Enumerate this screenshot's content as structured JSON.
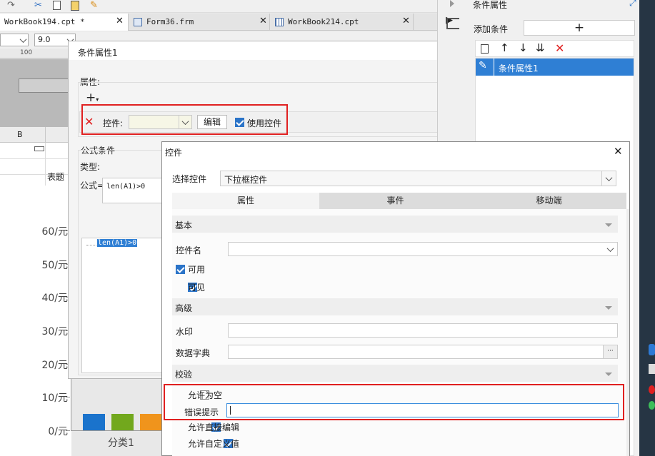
{
  "tabs": [
    {
      "label": "WorkBook194.cpt *"
    },
    {
      "label": "Form36.frm"
    },
    {
      "label": "WorkBook214.cpt"
    }
  ],
  "toolbar": {
    "font_size": "9.0",
    "ruler_mark": "100"
  },
  "sheet": {
    "col_b": "B",
    "header_cell": "表题"
  },
  "chart_data": {
    "type": "bar",
    "categories": [
      "分类1"
    ],
    "series": [
      {
        "values": [
          5
        ]
      },
      {
        "values": [
          5
        ]
      },
      {
        "values": [
          5
        ]
      }
    ],
    "yticks": [
      "0/元",
      "10/元",
      "20/元",
      "30/元",
      "40/元",
      "50/元",
      "60/元"
    ],
    "ylim": [
      0,
      60
    ],
    "colors": [
      "#1a73cc",
      "#72a81d",
      "#f0941c"
    ]
  },
  "cond_dialog": {
    "title": "条件属性1",
    "attr_label": "属性:",
    "control_label": "控件:",
    "edit_btn": "编辑",
    "use_control": "使用控件",
    "formula_cond": "公式条件",
    "type_label": "类型:",
    "formula_label": "公式=",
    "formula_value": "len(A1)>0",
    "tree_item": "len(A1)>0"
  },
  "right_panel": {
    "title": "条件属性",
    "add_condition": "添加条件",
    "add_btn": "+",
    "list": [
      {
        "label": "条件属性1"
      }
    ]
  },
  "ctrl_dialog": {
    "title": "控件",
    "select_label": "选择控件",
    "select_value": "下拉框控件",
    "tabs": [
      "属性",
      "事件",
      "移动端"
    ],
    "sec_basic": "基本",
    "ctrl_name": "控件名",
    "enabled": "可用",
    "visible": "可见",
    "sec_advanced": "高级",
    "watermark": "水印",
    "dict": "数据字典",
    "dict_btn": "···",
    "sec_validate": "校验",
    "allow_empty": "允许为空",
    "error_tip": "错误提示",
    "allow_edit": "允许直接编辑",
    "allow_custom": "允许自定义值"
  }
}
